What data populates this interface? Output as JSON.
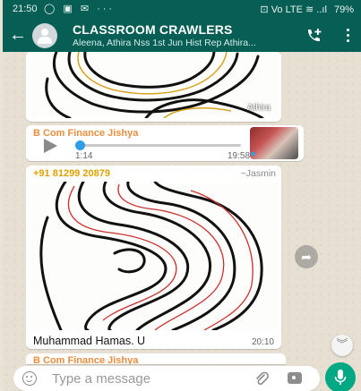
{
  "status_bar": {
    "time": "21:50",
    "notif_icons": "◯ ▣ ✉ ···",
    "right_icons": "⊡  Vo LTE ≋ ..ıl",
    "battery": "79%"
  },
  "header": {
    "title": "CLASSROOM CRAWLERS",
    "subtitle": "Aleena, Athira Nss 1st Jun Hist Rep Athira..."
  },
  "messages": {
    "image1": {
      "watermark": "Athira",
      "time": ""
    },
    "voice": {
      "sender": "B Com Finance Jishya",
      "duration": "1:14",
      "time": "19:58",
      "progress": 0.0
    },
    "image2": {
      "sender": "+91 81299 20879",
      "handle": "~Jasmin",
      "caption": "Muhammad Hamas. U",
      "time": "20:10"
    },
    "peek": {
      "sender": "B Com Finance Jishya"
    }
  },
  "input": {
    "placeholder": "Type a message"
  },
  "colors": {
    "header": "#075e54",
    "accent": "#00a884",
    "sender_voice": "#e88e3f",
    "sender_image": "#e0a100"
  }
}
